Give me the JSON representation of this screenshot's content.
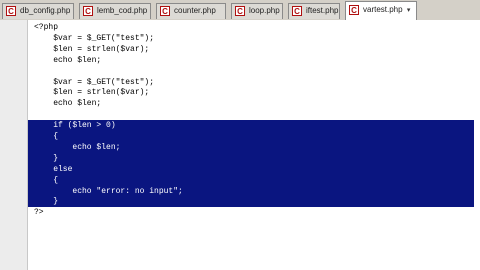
{
  "tabs": [
    {
      "label": "db_config.php",
      "active": false
    },
    {
      "label": "lemb_cod.php",
      "active": false
    },
    {
      "label": "counter.php",
      "active": false
    },
    {
      "label": "loop.php",
      "active": false
    },
    {
      "label": "iftest.php",
      "active": false
    },
    {
      "label": "vartest.php",
      "active": true
    }
  ],
  "tab_icon": "php-file-icon",
  "active_tab_chevron": "▾",
  "editor": {
    "code_lines": [
      {
        "text": "<?php",
        "selected": false
      },
      {
        "text": "    $var = $_GET(\"test\");",
        "selected": false
      },
      {
        "text": "    $len = strlen($var);",
        "selected": false
      },
      {
        "text": "    echo $len;",
        "selected": false
      },
      {
        "text": "",
        "selected": false
      },
      {
        "text": "    $var = $_GET(\"test\");",
        "selected": false
      },
      {
        "text": "    $len = strlen($var);",
        "selected": false
      },
      {
        "text": "    echo $len;",
        "selected": false
      },
      {
        "text": "",
        "selected": false
      },
      {
        "text": "    if ($len > 0)",
        "selected": true
      },
      {
        "text": "    {",
        "selected": true
      },
      {
        "text": "        echo $len;",
        "selected": true
      },
      {
        "text": "    }",
        "selected": true
      },
      {
        "text": "    else",
        "selected": true
      },
      {
        "text": "    {",
        "selected": true
      },
      {
        "text": "        echo \"error: no input\";",
        "selected": true
      },
      {
        "text": "    }",
        "selected": true
      },
      {
        "text": "?>",
        "selected": false
      }
    ]
  },
  "colors": {
    "selection": "#0a1580",
    "tab_icon_red": "#b01010"
  }
}
